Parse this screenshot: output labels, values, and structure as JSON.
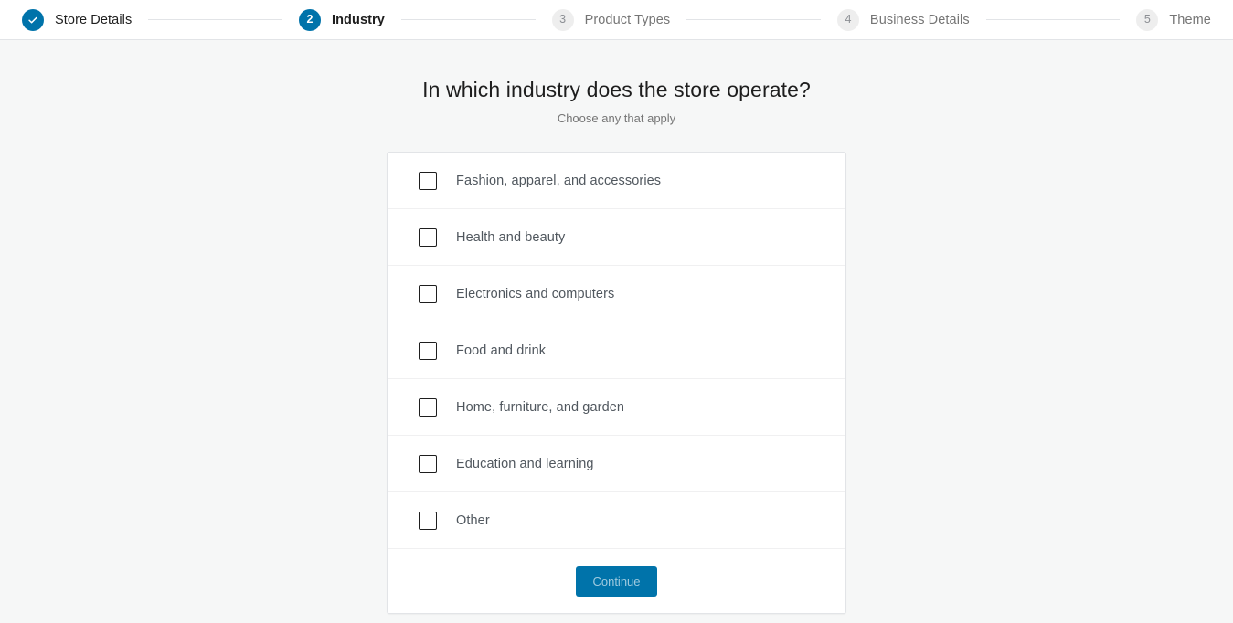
{
  "stepper": {
    "steps": [
      {
        "number": "1",
        "label": "Store Details",
        "state": "complete",
        "icon": "check-icon"
      },
      {
        "number": "2",
        "label": "Industry",
        "state": "current"
      },
      {
        "number": "3",
        "label": "Product Types",
        "state": "upcoming"
      },
      {
        "number": "4",
        "label": "Business Details",
        "state": "upcoming"
      },
      {
        "number": "5",
        "label": "Theme",
        "state": "upcoming"
      }
    ]
  },
  "main": {
    "title": "In which industry does the store operate?",
    "subtitle": "Choose any that apply",
    "options": [
      {
        "label": "Fashion, apparel, and accessories",
        "checked": false
      },
      {
        "label": "Health and beauty",
        "checked": false
      },
      {
        "label": "Electronics and computers",
        "checked": false
      },
      {
        "label": "Food and drink",
        "checked": false
      },
      {
        "label": "Home, furniture, and garden",
        "checked": false
      },
      {
        "label": "Education and learning",
        "checked": false
      },
      {
        "label": "Other",
        "checked": false
      }
    ],
    "continue_label": "Continue"
  },
  "colors": {
    "accent": "#0073aa",
    "page_background": "#f6f7f7",
    "card_background": "#ffffff",
    "border": "#e2e4e7",
    "text_primary": "#1e1e1e",
    "text_secondary": "#50575e",
    "text_muted": "#757575"
  }
}
